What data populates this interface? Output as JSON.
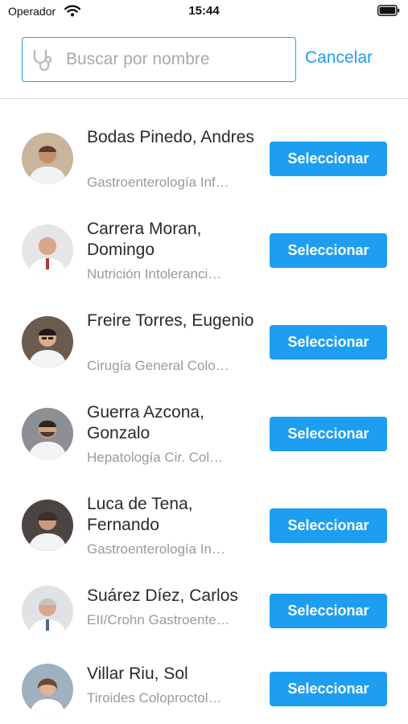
{
  "status_bar": {
    "carrier": "Operador",
    "time": "15:44"
  },
  "search": {
    "placeholder": "Buscar por nombre",
    "value": "",
    "cancel_label": "Cancelar",
    "icon": "stethoscope-icon"
  },
  "colors": {
    "accent": "#1e9ef0",
    "button_text": "#ffffff",
    "secondary_text": "#9a9a9a"
  },
  "doctors": [
    {
      "name": "Bodas Pinedo, Andres",
      "specialties": "Gastroenterología Inf…",
      "button_label": "Seleccionar"
    },
    {
      "name": "Carrera Moran, Domingo",
      "specialties": "Nutrición   Intoleranci…",
      "button_label": "Seleccionar"
    },
    {
      "name": "Freire Torres, Eugenio",
      "specialties": "Cirugía General   Colo…",
      "button_label": "Seleccionar"
    },
    {
      "name": "Guerra Azcona, Gonzalo",
      "specialties": "Hepatología   Cir. Col…",
      "button_label": "Seleccionar"
    },
    {
      "name": "Luca de Tena, Fernando",
      "specialties": "Gastroenterología   In…",
      "button_label": "Seleccionar"
    },
    {
      "name": "Suárez Díez, Carlos",
      "specialties": "EII/Crohn   Gastroente…",
      "button_label": "Seleccionar"
    },
    {
      "name": "Villar Riu, Sol",
      "specialties": "Tiroides   Coloproctol…",
      "button_label": "Seleccionar"
    }
  ]
}
